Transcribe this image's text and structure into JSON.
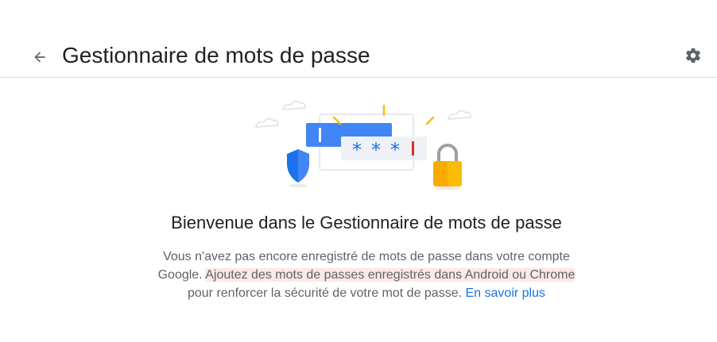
{
  "header": {
    "title": "Gestionnaire de mots de passe",
    "back_icon": "arrow-back-icon",
    "settings_icon": "gear-icon"
  },
  "illustration": {
    "password_mask": "***"
  },
  "main": {
    "welcome_title": "Bienvenue dans le Gestionnaire de mots de passe",
    "description_part1": "Vous n'avez pas encore enregistré de mots de passe dans votre compte Google.",
    "description_highlight": "Ajoutez des mots de passes enregistrés dans Android ou Chrome",
    "description_part2": "pour renforcer la sécurité de votre mot de passe.",
    "learn_more": "En savoir plus"
  },
  "colors": {
    "accent": "#1a73e8",
    "highlight": "#fce8e6",
    "shield": "#1a73e8",
    "lock": "#f9ab00"
  }
}
